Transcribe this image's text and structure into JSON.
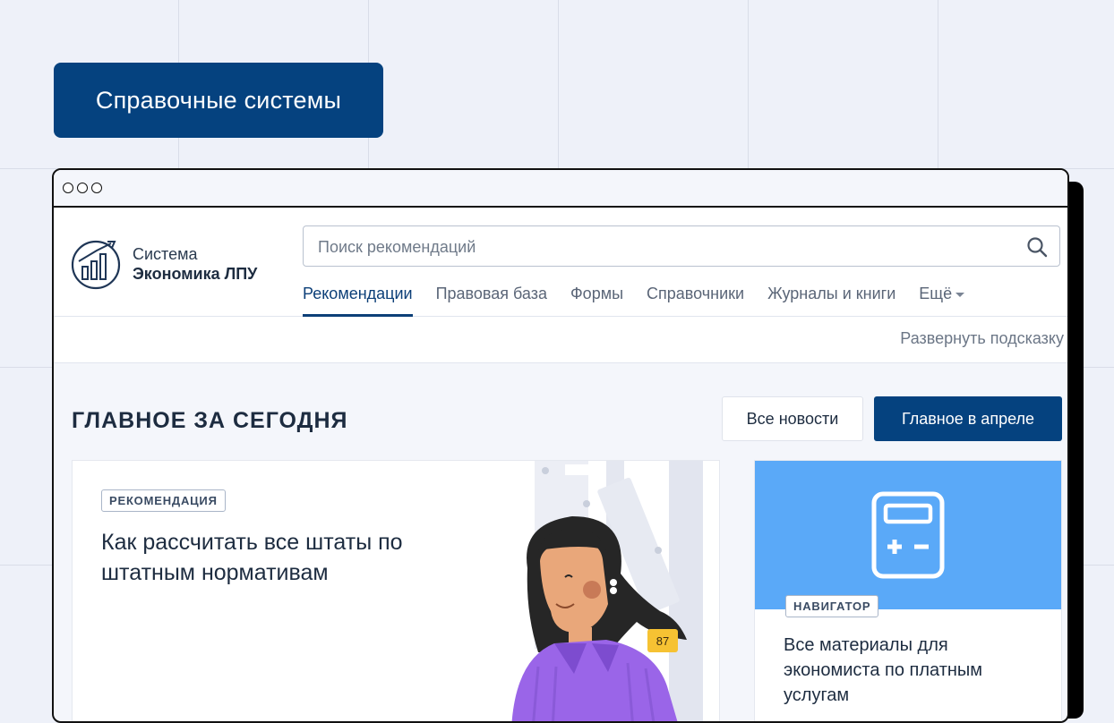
{
  "hero": {
    "label": "Справочные системы"
  },
  "brand": {
    "line1": "Система",
    "line2": "Экономика ЛПУ"
  },
  "search": {
    "placeholder": "Поиск рекомендаций"
  },
  "nav": {
    "items": [
      {
        "label": "Рекомендации",
        "active": true
      },
      {
        "label": "Правовая база"
      },
      {
        "label": "Формы"
      },
      {
        "label": "Справочники"
      },
      {
        "label": "Журналы и книги"
      }
    ],
    "more": "Ещё"
  },
  "hint": {
    "label": "Развернуть подсказку"
  },
  "section": {
    "title": "ГЛАВНОЕ ЗА СЕГОДНЯ",
    "btn_all": "Все новости",
    "btn_main": "Главное в апреле"
  },
  "card_main": {
    "tag": "РЕКОМЕНДАЦИЯ",
    "title": "Как рассчитать все штаты по штатным нормативам",
    "badge": "87"
  },
  "card_side": {
    "tag": "НАВИГАТОР",
    "title": "Все материалы для экономиста по платным услугам"
  },
  "colors": {
    "brand": "#05427f",
    "accent_blue": "#5aa9f8",
    "background": "#eef1f9"
  }
}
